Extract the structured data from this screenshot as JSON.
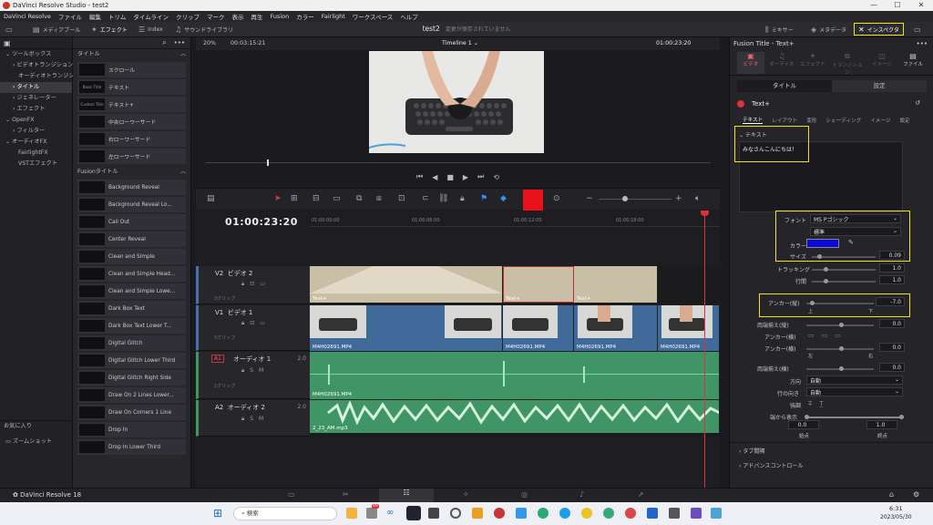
{
  "window": {
    "title": "DaVinci Resolve Studio - test2"
  },
  "menu": [
    "DaVinci Resolve",
    "ファイル",
    "編集",
    "トリム",
    "タイムライン",
    "クリップ",
    "マーク",
    "表示",
    "再生",
    "Fusion",
    "カラー",
    "Fairlight",
    "ワークスペース",
    "ヘルプ"
  ],
  "toolbar": {
    "media_pool": "メディアプール",
    "effects": "エフェクト",
    "index": "Index",
    "sound_library": "サウンドライブラリ",
    "project_name": "test2",
    "save_status": "変更が保存されていません",
    "mixer": "ミキサー",
    "metadata": "メタデータ",
    "inspector": "インスペクタ"
  },
  "sidebar": {
    "items": [
      "ツールボックス",
      "ビデオトランジション",
      "オーディオトランジション",
      "タイトル",
      "ジェネレーター",
      "エフェクト",
      "OpenFX",
      "フィルター",
      "オーディオFX",
      "FairlightFX",
      "VSTエフェクト"
    ],
    "favorites": "お気に入り",
    "shortcut": "ズームショット"
  },
  "library": {
    "section1": "タイトル",
    "titles": [
      {
        "thumb": "",
        "label": "スクロール"
      },
      {
        "thumb": "Basic Title",
        "label": "テキスト"
      },
      {
        "thumb": "Custom Title",
        "label": "テキスト+"
      },
      {
        "thumb": "",
        "label": "中央ローワーサード"
      },
      {
        "thumb": "",
        "label": "右ローワーサード"
      },
      {
        "thumb": "",
        "label": "左ローワーサード"
      }
    ],
    "section2": "Fusionタイトル",
    "fusion_titles": [
      "Background Reveal",
      "Background Reveal Lo...",
      "Call Out",
      "Center Reveal",
      "Clean and Simple",
      "Clean and Simple Head...",
      "Clean and Simple Lowe...",
      "Dark Box Text",
      "Dark Box Text Lower T...",
      "Digital Glitch",
      "Digital Glitch Lower Third",
      "Digital Glitch Right Side",
      "Draw On 2 Lines Lower...",
      "Draw On Corners 1 Line",
      "Drop In",
      "Drop In Lower Third"
    ]
  },
  "viewer": {
    "zoom": "20%",
    "timecode_left": "00:03:15:21",
    "timeline_name": "Timeline 1",
    "timecode_right": "01:00:23:20"
  },
  "timeline": {
    "current_tc": "01:00:23:20",
    "ruler": [
      "01:00:00:00",
      "01:00:06:00",
      "01:00:12:00",
      "01:00:18:00"
    ],
    "tracks": [
      {
        "id": "V2",
        "name": "ビデオ 2",
        "sub": "3クリップ"
      },
      {
        "id": "V1",
        "name": "ビデオ 1",
        "sub": "5クリップ"
      },
      {
        "id": "A1",
        "name": "オーディオ 1",
        "level": "2.0",
        "sub": "1クリップ"
      },
      {
        "id": "A2",
        "name": "オーディオ 2",
        "level": "2.0",
        "sub": ""
      }
    ],
    "v2_clips": [
      "Text+",
      "Text+",
      "Text+"
    ],
    "v1_clips": [
      "M4H02691.MP4",
      "M4H02691.MP4",
      "M4H02691.MP4",
      "M4H02691.MP4",
      "M4H02691.MP4"
    ],
    "a1_clip": "M4H02691.MP4",
    "a2_clip": "2_23_AM.mp3"
  },
  "inspector": {
    "panel_title": "Fusion Title - Text+",
    "tabs": [
      "ビデオ",
      "オーディオ",
      "エフェクト",
      "トランジション",
      "イメージ",
      "ファイル"
    ],
    "subtabs": [
      "タイトル",
      "設定"
    ],
    "node": "Text+",
    "node_tabs": [
      "テキスト",
      "レイアウト",
      "変形",
      "シェーディング",
      "イメージ",
      "設定"
    ],
    "text_section": "テキスト",
    "text_value": "みなさんこんにちは！",
    "font_label": "フォント",
    "font": "MS Pゴシック",
    "style": "標準",
    "color_label": "カラー",
    "color_value": "#0a0adc",
    "size_label": "サイズ",
    "size": "0.09",
    "tracking_label": "トラッキング",
    "tracking": "1.0",
    "linespacing_label": "行間",
    "linespacing": "1.0",
    "anchor_v_label": "アンカー(縦)",
    "anchor_v": "-7.0",
    "anchor_v_top": "上",
    "anchor_v_bottom": "下",
    "justify_v_label": "両端揃え(縦)",
    "justify_v": "0.0",
    "anchor_h_label": "アンカー(横)",
    "anchor_h2_label": "アンカー(横)",
    "anchor_h": "0.0",
    "left": "左",
    "right": "右",
    "justify_h_label": "両端揃え(横)",
    "justify_h": "0.0",
    "direction_label": "方向",
    "direction": "自動",
    "line_dir_label": "行の向き",
    "line_dir": "自動",
    "emphasis_label": "強調",
    "write_on_label": "端から表示",
    "write_start": "0.0",
    "write_end": "1.0",
    "start_label": "始点",
    "end_label": "終点",
    "tab_spacing": "タブ間隔",
    "advanced": "アドバンスコントロール"
  },
  "bottom": {
    "app_label": "DaVinci Resolve 18"
  },
  "taskbar": {
    "search": "検索",
    "time": "6:31",
    "date": "2023/05/30",
    "badge": "99"
  }
}
